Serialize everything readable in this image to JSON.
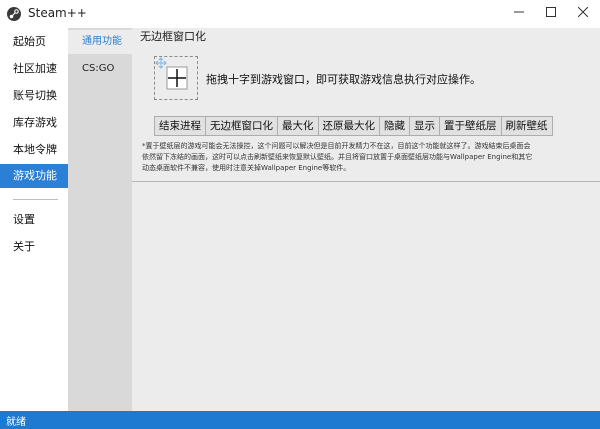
{
  "window": {
    "title": "Steam++",
    "controls": [
      "minimize-icon",
      "maximize-icon",
      "close-icon"
    ]
  },
  "sidebar": {
    "items": [
      {
        "label": "起始页",
        "active": false
      },
      {
        "label": "社区加速",
        "active": false
      },
      {
        "label": "账号切换",
        "active": false
      },
      {
        "label": "库存游戏",
        "active": false
      },
      {
        "label": "本地令牌",
        "active": false
      },
      {
        "label": "游戏功能",
        "active": true
      }
    ],
    "bottom_items": [
      {
        "label": "设置"
      },
      {
        "label": "关于"
      }
    ]
  },
  "subnav": {
    "items": [
      {
        "label": "通用功能",
        "active": true
      },
      {
        "label": "CS:GO",
        "active": false
      }
    ]
  },
  "main": {
    "title": "无边框窗口化",
    "crosshair_icon": "crosshair-icon",
    "instruction": "拖拽十字到游戏窗口，即可获取游戏信息执行对应操作。",
    "buttons": [
      "结束进程",
      "无边框窗口化",
      "最大化",
      "还原最大化",
      "隐藏",
      "显示",
      "置于壁纸层",
      "刷新壁纸"
    ],
    "note_lines": [
      "*置于壁纸层的游戏可能会无法操控，这个问题可以解决但是目前开发精力不在这，目前这个功能就这样了。游戏结束后桌面会",
      "依然留下冻结的画面，这时可以点击刷新壁纸来恢复默认壁纸。并且将窗口放置于桌面壁纸层功能与Wallpaper Engine和其它",
      "动态桌面软件不兼容，使用时注意关掉Wallpaper Engine等软件。"
    ]
  },
  "statusbar": {
    "text": "就绪"
  },
  "colors": {
    "accent": "#2b7fd4",
    "statusbar": "#1e7ad1",
    "subpanel_bg": "#d9d9d9",
    "content_bg": "#ececec"
  }
}
